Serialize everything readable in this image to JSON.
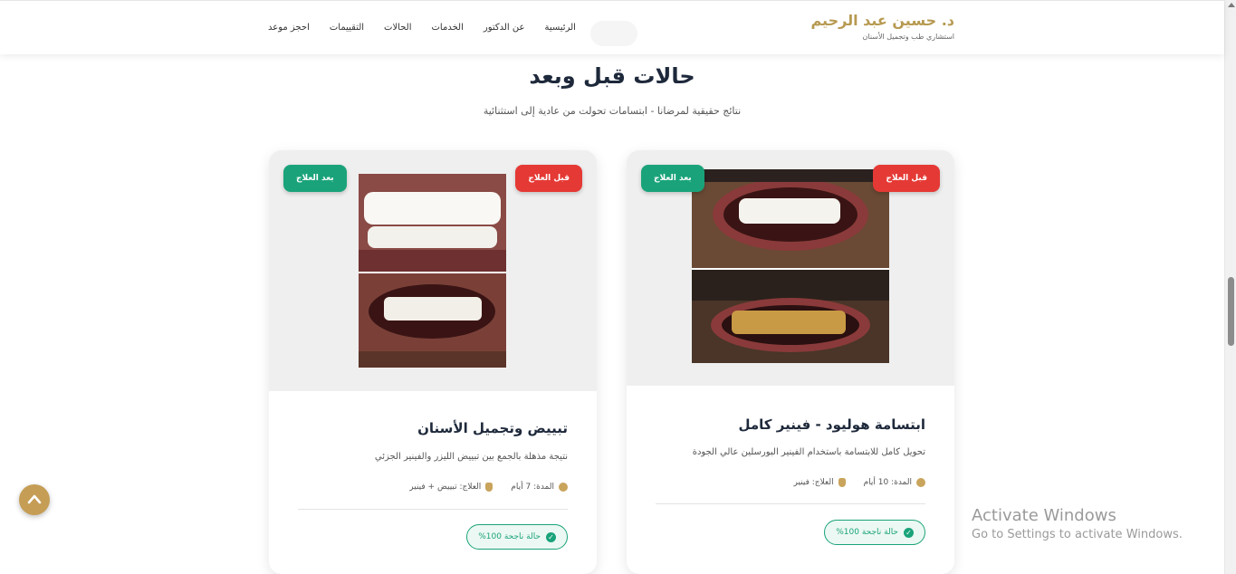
{
  "header": {
    "brand_name": "د. حسين عبد الرحيم",
    "brand_tagline": "استشاري طب وتجميل الأسنان",
    "nav": [
      "الرئيسية",
      "عن الدكتور",
      "الخدمات",
      "الحالات",
      "التقييمات",
      "احجز موعد"
    ]
  },
  "section": {
    "title": "حالات قبل وبعد",
    "subtitle": "نتائج حقيقية لمرضانا - ابتسامات تحولت من عادية إلى استثنائية"
  },
  "cards": [
    {
      "badge_before": "قبل العلاج",
      "badge_after": "بعد العلاج",
      "title": "ابتسامة هوليود - فينير كامل",
      "description": "تحويل كامل للابتسامة باستخدام الفينير البورسلين عالي الجودة",
      "duration": "المدة: 10 أيام",
      "treatment": "العلاج: فينير",
      "status": "حالة ناجحة 100%"
    },
    {
      "badge_before": "قبل العلاج",
      "badge_after": "بعد العلاج",
      "title": "تبييض وتجميل الأسنان",
      "description": "نتيجة مذهلة بالجمع بين تبييض الليزر والفينير الجزئي",
      "duration": "المدة: 7 أيام",
      "treatment": "العلاج: تبييض + فينير",
      "status": "حالة ناجحة 100%"
    }
  ],
  "watermark": {
    "line1": "Activate Windows",
    "line2": "Go to Settings to activate Windows."
  },
  "colors": {
    "brand_gold": "#b79a52",
    "before_red": "#e53935",
    "after_green": "#1aa37a",
    "scroll_top_button": "#c59d55"
  },
  "icons": [
    "clock-icon",
    "tooth-icon",
    "check-circle-icon",
    "chevron-up-icon"
  ]
}
